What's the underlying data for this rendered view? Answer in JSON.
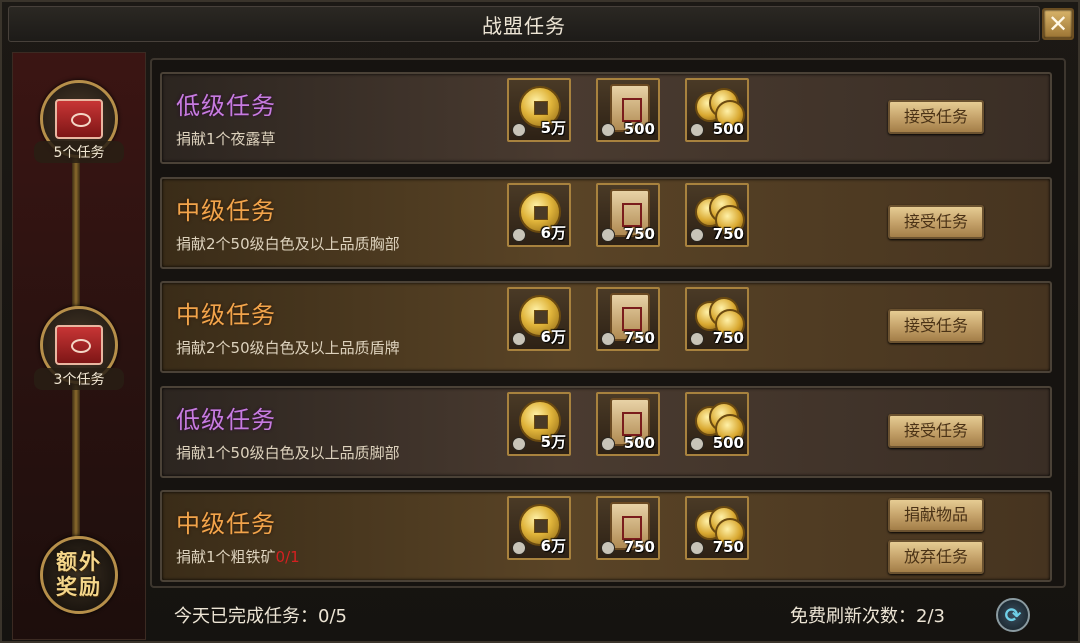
{
  "window": {
    "title": "战盟任务",
    "close_glyph": "✕"
  },
  "sidebar": {
    "milestones": [
      {
        "label": "5个任务",
        "icon": "treasure-chest-icon"
      },
      {
        "label": "3个任务",
        "icon": "treasure-chest-icon"
      }
    ],
    "extra_reward": {
      "label_line1": "额外",
      "label_line2": "奖励"
    }
  },
  "tasks": [
    {
      "level": "低级任务",
      "tier": "low",
      "desc": "捐献1个夜露草",
      "progress": "",
      "rewards": [
        {
          "icon": "copper-coin-icon",
          "amount": "5万"
        },
        {
          "icon": "merit-token-icon",
          "amount": "500"
        },
        {
          "icon": "coin-stack-icon",
          "amount": "500"
        }
      ],
      "buttons": [
        "接受任务"
      ]
    },
    {
      "level": "中级任务",
      "tier": "mid",
      "desc": "捐献2个50级白色及以上品质胸部",
      "progress": "",
      "rewards": [
        {
          "icon": "copper-coin-icon",
          "amount": "6万"
        },
        {
          "icon": "merit-token-icon",
          "amount": "750"
        },
        {
          "icon": "coin-stack-icon",
          "amount": "750"
        }
      ],
      "buttons": [
        "接受任务"
      ]
    },
    {
      "level": "中级任务",
      "tier": "mid",
      "desc": "捐献2个50级白色及以上品质盾牌",
      "progress": "",
      "rewards": [
        {
          "icon": "copper-coin-icon",
          "amount": "6万"
        },
        {
          "icon": "merit-token-icon",
          "amount": "750"
        },
        {
          "icon": "coin-stack-icon",
          "amount": "750"
        }
      ],
      "buttons": [
        "接受任务"
      ]
    },
    {
      "level": "低级任务",
      "tier": "low",
      "desc": "捐献1个50级白色及以上品质脚部",
      "progress": "",
      "rewards": [
        {
          "icon": "copper-coin-icon",
          "amount": "5万"
        },
        {
          "icon": "merit-token-icon",
          "amount": "500"
        },
        {
          "icon": "coin-stack-icon",
          "amount": "500"
        }
      ],
      "buttons": [
        "接受任务"
      ]
    },
    {
      "level": "中级任务",
      "tier": "mid",
      "desc": "捐献1个粗铁矿",
      "progress": "0/1",
      "rewards": [
        {
          "icon": "copper-coin-icon",
          "amount": "6万"
        },
        {
          "icon": "merit-token-icon",
          "amount": "750"
        },
        {
          "icon": "coin-stack-icon",
          "amount": "750"
        }
      ],
      "buttons": [
        "捐献物品",
        "放弃任务"
      ]
    }
  ],
  "footer": {
    "completed_label": "今天已完成任务：",
    "completed_value": "0/5",
    "refresh_label": "免费刷新次数：",
    "refresh_value": "2/3",
    "refresh_icon": "refresh-icon"
  },
  "colors": {
    "low_tier": "#c77be0",
    "mid_tier": "#f2a44b",
    "progress_red": "#d42020",
    "button_gold": "#c3a068"
  }
}
